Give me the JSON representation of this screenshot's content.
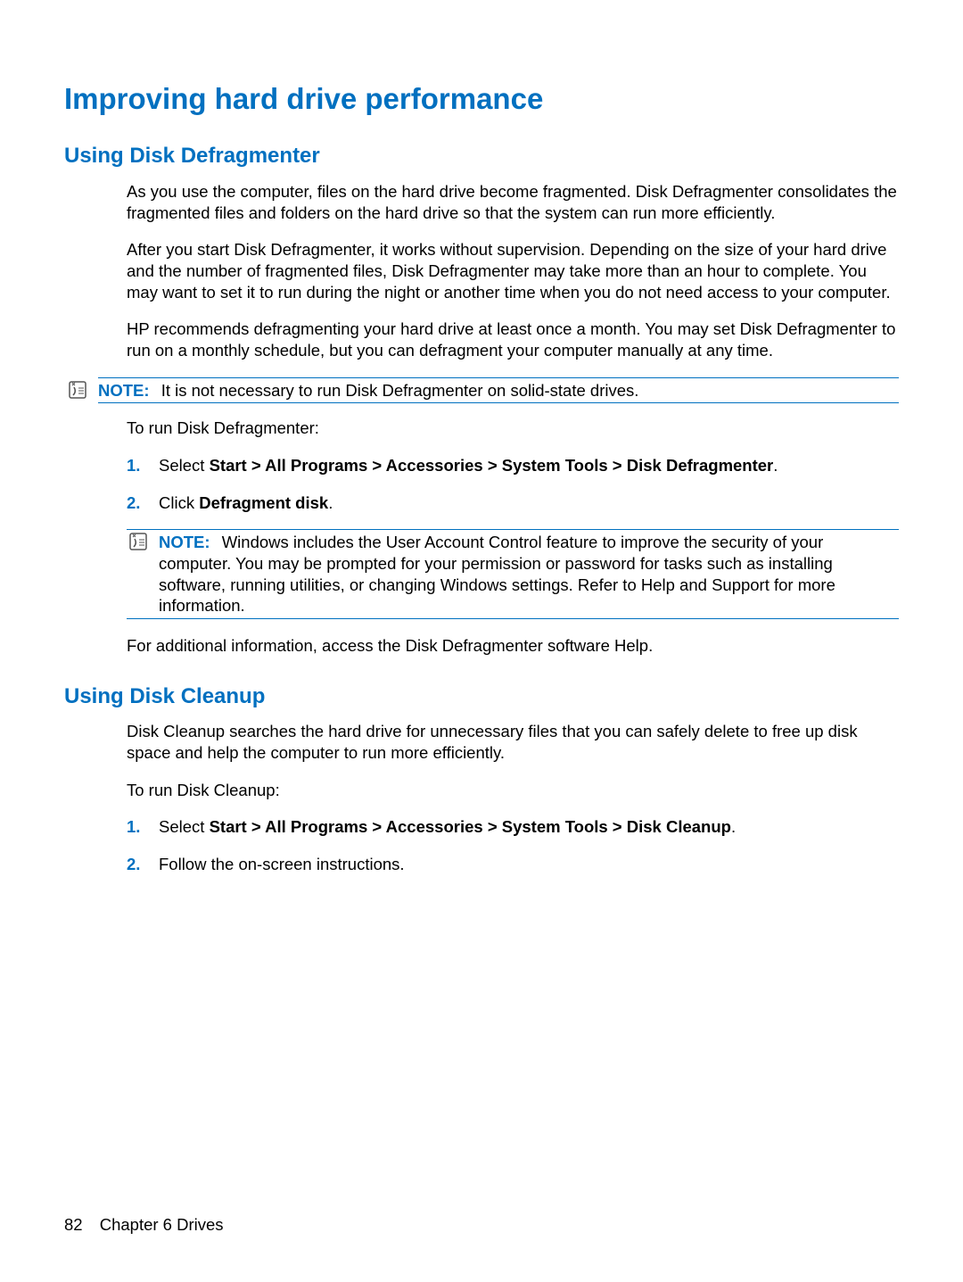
{
  "title": "Improving hard drive performance",
  "section1": {
    "heading": "Using Disk Defragmenter",
    "p1": "As you use the computer, files on the hard drive become fragmented. Disk Defragmenter consolidates the fragmented files and folders on the hard drive so that the system can run more efficiently.",
    "p2": "After you start Disk Defragmenter, it works without supervision. Depending on the size of your hard drive and the number of fragmented files, Disk Defragmenter may take more than an hour to complete. You may want to set it to run during the night or another time when you do not need access to your computer.",
    "p3": "HP recommends defragmenting your hard drive at least once a month. You may set Disk Defragmenter to run on a monthly schedule, but you can defragment your computer manually at any time.",
    "note1_label": "NOTE:",
    "note1_text": "It is not necessary to run Disk Defragmenter on solid-state drives.",
    "p4": "To run Disk Defragmenter:",
    "step1_num": "1.",
    "step1_prefix": "Select ",
    "step1_bold": "Start > All Programs > Accessories > System Tools > Disk Defragmenter",
    "step1_suffix": ".",
    "step2_num": "2.",
    "step2_prefix": "Click ",
    "step2_bold": "Defragment disk",
    "step2_suffix": ".",
    "note2_label": "NOTE:",
    "note2_text": "Windows includes the User Account Control feature to improve the security of your computer. You may be prompted for your permission or password for tasks such as installing software, running utilities, or changing Windows settings. Refer to Help and Support for more information.",
    "p5": "For additional information, access the Disk Defragmenter software Help."
  },
  "section2": {
    "heading": "Using Disk Cleanup",
    "p1": "Disk Cleanup searches the hard drive for unnecessary files that you can safely delete to free up disk space and help the computer to run more efficiently.",
    "p2": "To run Disk Cleanup:",
    "step1_num": "1.",
    "step1_prefix": "Select ",
    "step1_bold": "Start > All Programs > Accessories > System Tools > Disk Cleanup",
    "step1_suffix": ".",
    "step2_num": "2.",
    "step2_text": "Follow the on-screen instructions."
  },
  "footer": {
    "page_number": "82",
    "chapter": "Chapter 6   Drives"
  }
}
